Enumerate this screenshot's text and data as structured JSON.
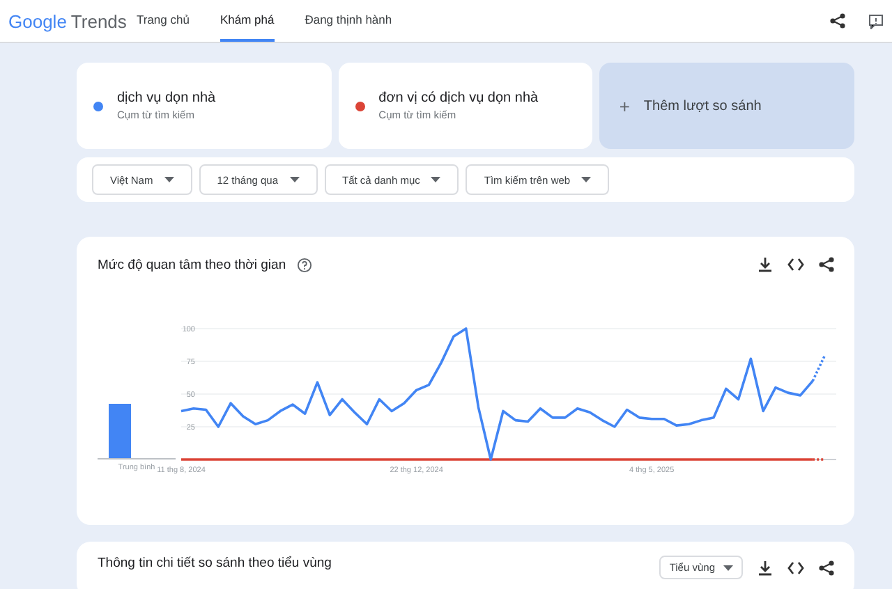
{
  "header": {
    "logo_google": "Google",
    "logo_product": "Trends",
    "tabs": [
      {
        "label": "Trang chủ",
        "selected": false
      },
      {
        "label": "Khám phá",
        "selected": true
      },
      {
        "label": "Đang thịnh hành",
        "selected": false
      }
    ]
  },
  "terms": [
    {
      "name": "dịch vụ dọn nhà",
      "subtitle": "Cụm từ tìm kiếm",
      "color": "#4285f4"
    },
    {
      "name": "đơn vị có dịch vụ dọn nhà",
      "subtitle": "Cụm từ tìm kiếm",
      "color": "#db4437"
    }
  ],
  "add_compare": {
    "icon": "+",
    "label": "Thêm lượt so sánh"
  },
  "filters": [
    "Việt Nam",
    "12 tháng qua",
    "Tất cả danh mục",
    "Tìm kiếm trên web"
  ],
  "interest_card": {
    "title": "Mức độ quan tâm theo thời gian",
    "average_label": "Trung bình",
    "average": [
      {
        "level": 0.42
      }
    ],
    "chart_data": {
      "type": "line",
      "categories": [
        "11 thg 8, 2024",
        null,
        null,
        null,
        null,
        null,
        null,
        null,
        null,
        null,
        null,
        null,
        null,
        null,
        null,
        null,
        null,
        null,
        null,
        "22 thg 12, 2024",
        null,
        null,
        null,
        null,
        null,
        null,
        null,
        null,
        null,
        null,
        null,
        null,
        null,
        null,
        null,
        null,
        null,
        null,
        "4 thg 5, 2025",
        null,
        null,
        null,
        null,
        null,
        null,
        null,
        null,
        null,
        null,
        null,
        null,
        null,
        null
      ],
      "series": [
        {
          "color": "#4285f4",
          "line_style": "solid",
          "values": [
            37,
            39,
            38,
            25,
            43,
            33,
            27,
            30,
            37,
            42,
            35,
            59,
            34,
            46,
            36,
            27,
            46,
            37,
            43,
            53,
            57,
            74,
            94,
            100,
            40,
            0,
            37,
            30,
            29,
            39,
            32,
            32,
            39,
            36,
            30,
            25,
            38,
            32,
            31,
            31,
            26,
            27,
            30,
            32,
            54,
            46,
            77,
            37,
            55,
            51,
            49,
            60,
            80
          ]
        },
        {
          "color": "#db4437",
          "line_style": "solid",
          "values": [
            0,
            0,
            0,
            0,
            0,
            0,
            0,
            0,
            0,
            0,
            0,
            0,
            0,
            0,
            0,
            0,
            0,
            0,
            0,
            0,
            0,
            0,
            0,
            0,
            0,
            0,
            0,
            0,
            0,
            0,
            0,
            0,
            0,
            0,
            0,
            0,
            0,
            0,
            0,
            0,
            0,
            0,
            0,
            0,
            0,
            0,
            0,
            0,
            0,
            0,
            0,
            0,
            0
          ]
        }
      ],
      "ylim": [
        0,
        100
      ],
      "yticks": [
        25,
        50,
        75,
        100
      ],
      "grid": true
    }
  },
  "region_card": {
    "title": "Thông tin chi tiết so sánh theo tiểu vùng",
    "dropdown": "Tiểu vùng"
  }
}
